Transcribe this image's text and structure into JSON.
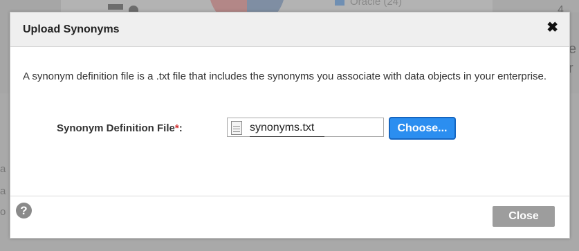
{
  "background": {
    "legend_text": "Oracle (24)",
    "number_glyph": "4",
    "left_chars": [
      "a",
      "a",
      "o"
    ],
    "right_chars": [
      "e",
      "r"
    ]
  },
  "dialog": {
    "title": "Upload Synonyms",
    "close_glyph": "✖",
    "description": "A synonym definition file is a .txt file that includes the synonyms you associate with data objects in your enterprise.",
    "field": {
      "label": "Synonym Definition File",
      "required_marker": "*",
      "label_suffix": ":",
      "file_name": "synonyms.txt",
      "choose_label": "Choose..."
    },
    "footer": {
      "help_glyph": "?",
      "close_label": "Close"
    }
  },
  "colors": {
    "primary_button": "#2b8ef0",
    "secondary_button": "#9d9d9d",
    "required": "#d32f2f"
  }
}
